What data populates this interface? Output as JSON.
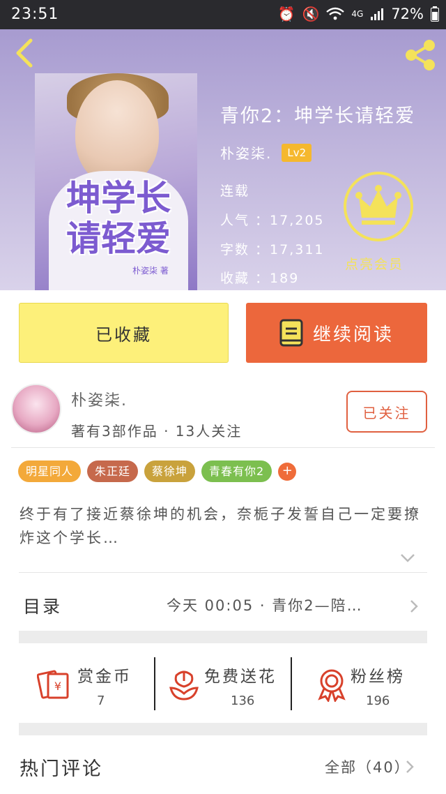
{
  "status_bar": {
    "time": "23:51",
    "network": "4G",
    "battery": "72%"
  },
  "header": {
    "cover": {
      "title_line1": "坤学长",
      "title_line2": "请轻爱",
      "author": "朴姿柒 著"
    },
    "book_title": "青你2：坤学长请轻爱",
    "author": "朴姿柒.",
    "level": "Lv2",
    "status": "连载",
    "popularity": "人气 ：17,205",
    "word_count": "字数 ：17,311",
    "favorites": "收藏 ：189",
    "vip_label": "点亮会员",
    "accent_yellow": "#f4e25a"
  },
  "buttons": {
    "favorited": "已收藏",
    "continue_reading": "继续阅读"
  },
  "author_row": {
    "name": "朴姿柒.",
    "works": "著有3部作品 · 13人关注",
    "follow": "已关注"
  },
  "tags": [
    {
      "label": "明星同人",
      "color": "#f3a93a"
    },
    {
      "label": "朱正廷",
      "color": "#c6694c"
    },
    {
      "label": "蔡徐坤",
      "color": "#c9a23c"
    },
    {
      "label": "青春有你2",
      "color": "#7cbf4f"
    }
  ],
  "tag_more": "+",
  "description": "终于有了接近蔡徐坤的机会，奈栀子发誓自己一定要撩炸这个学长…",
  "toc": {
    "label": "目录",
    "latest": "今天  00:05  ·  青你2—陪…"
  },
  "actions": [
    {
      "label": "赏金币",
      "count": "7"
    },
    {
      "label": "免费送花",
      "count": "136"
    },
    {
      "label": "粉丝榜",
      "count": "196"
    }
  ],
  "comments": {
    "title": "热门评论",
    "all": "全部（40）"
  },
  "colors": {
    "accent_orange": "#ec673c",
    "fav_yellow": "#fdf07a"
  }
}
